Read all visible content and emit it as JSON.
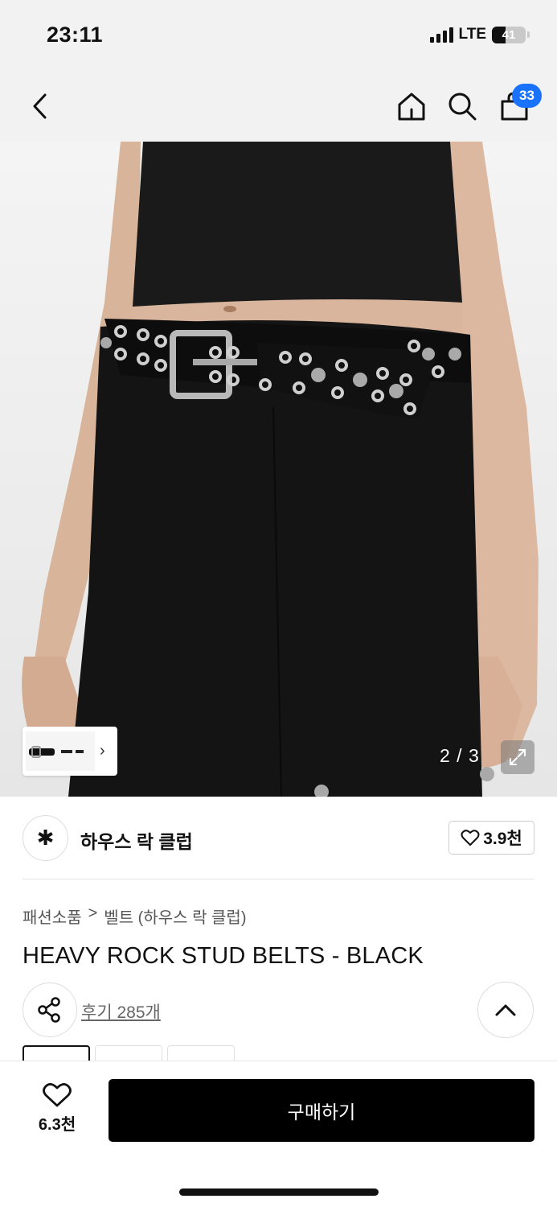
{
  "status_bar": {
    "time": "23:11",
    "network": "LTE",
    "battery": "41",
    "battery_level": 0.41
  },
  "nav": {
    "back_icon": "chevron-left-icon",
    "home_icon": "home-icon",
    "search_icon": "search-icon",
    "cart_icon": "shopping-bag-icon",
    "cart_count": "33"
  },
  "gallery": {
    "pager": "2 / 3",
    "expand_icon": "expand-icon",
    "thumb_chevron": "›"
  },
  "brand": {
    "logo_glyph": "✱",
    "name": "하우스 락 클럽",
    "like_count": "3.9천"
  },
  "breadcrumb": {
    "category": "패션소품",
    "separator": ">",
    "subcategory": "벨트 (하우스 락 클럽)"
  },
  "product": {
    "title": "HEAVY ROCK STUD BELTS - BLACK",
    "review_link": "후기 285개"
  },
  "bottom_bar": {
    "wish_count": "6.3천",
    "buy_label": "구매하기"
  },
  "colors": {
    "accent": "#1a73ff",
    "buy_button": "#000000"
  }
}
